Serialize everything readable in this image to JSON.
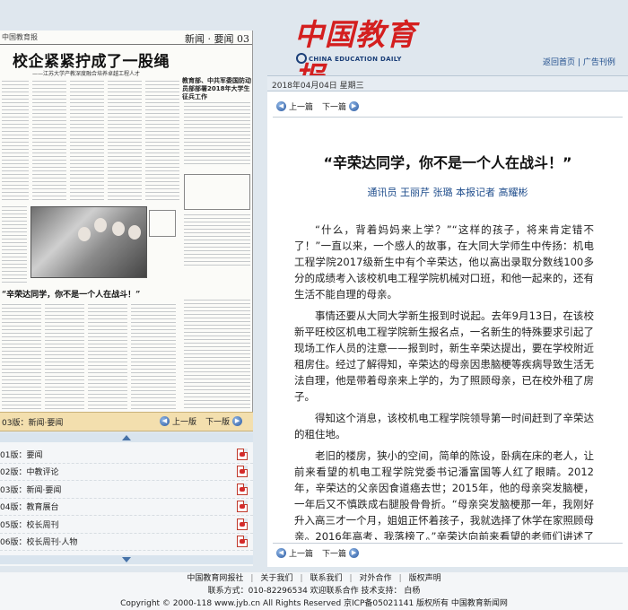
{
  "paper": {
    "top_left": "中国教育报",
    "top_right": "新闻 · 要闻 03",
    "headline": "校企紧紧拧成了一股绳",
    "subhead": "——江苏大学产教深度融合培养卓越工程人才",
    "side_headline": "教育部、中共军委国防动员部部署2018年大学生征兵工作",
    "title2": "“辛荣达同学，你不是一个人在战斗！”"
  },
  "pager": {
    "current": "03版：新闻·要闻",
    "prev": "上一版",
    "next": "下一版"
  },
  "editions": [
    {
      "label": "01版：要闻"
    },
    {
      "label": "02版：中教评论"
    },
    {
      "label": "03版：新闻·要闻"
    },
    {
      "label": "04版：教育展台"
    },
    {
      "label": "05版：校长周刊"
    },
    {
      "label": "06版：校长周刊·人物"
    }
  ],
  "header": {
    "logo_cn": "中国教育报",
    "logo_en": "CHINA EDUCATION DAILY",
    "link_home": "返回首页",
    "link_sep": "|",
    "link_ads": "广告刊例",
    "date": "2018年04月04日  星期三"
  },
  "article": {
    "prev": "上一篇",
    "next": "下一篇",
    "title": "“辛荣达同学，你不是一个人在战斗！”",
    "byline": "通讯员 王丽芹 张璐 本报记者 高耀彬",
    "paragraphs": [
      "“什么，背着妈妈来上学？”“这样的孩子，将来肯定错不了！”一直以来，一个感人的故事，在大同大学师生中传扬：机电工程学院2017级新生中有个辛荣达，他以高出录取分数线100多分的成绩考入该校机电工程学院机械对口班，和他一起来的，还有生活不能自理的母亲。",
      "事情还要从大同大学新生报到时说起。去年9月13日，在该校新平旺校区机电工程学院新生报名点，一名新生的特殊要求引起了现场工作人员的注意——报到时，新生辛荣达提出，要在学校附近租房住。经过了解得知，辛荣达的母亲因患脑梗等疾病导致生活无法自理，他是带着母亲来上学的，为了照顾母亲，已在校外租了房子。",
      "得知这个消息，该校机电工程学院领导第一时间赶到了辛荣达的租住地。",
      "老旧的楼房，狭小的空间，简单的陈设，卧病在床的老人，让前来看望的机电工程学院党委书记潘富国等人红了眼睛。2012年，辛荣达的父亲因食道癌去世；2015年，他的母亲突发脑梗，一年后又不慎跌成右腿股骨骨折。“母亲突发脑梗那一年，我刚好升入高三才一个月，姐姐正怀着孩子，我就选择了休学在家照顾母亲。2016年高考，我落榜了。”辛荣达向前来看望的老师们讲述了自己的经历。"
    ]
  },
  "footer": {
    "links": [
      "中国教育网报社",
      "关于我们",
      "联系我们",
      "对外合作",
      "版权声明"
    ],
    "contact": "联系方式：010-82296534 欢迎联系合作 技术支持：  白杨",
    "copyright": "Copyright © 2000-118 www.jyb.cn All Rights Reserved 京ICP备05021141 版权所有 中国教育新闻网"
  }
}
